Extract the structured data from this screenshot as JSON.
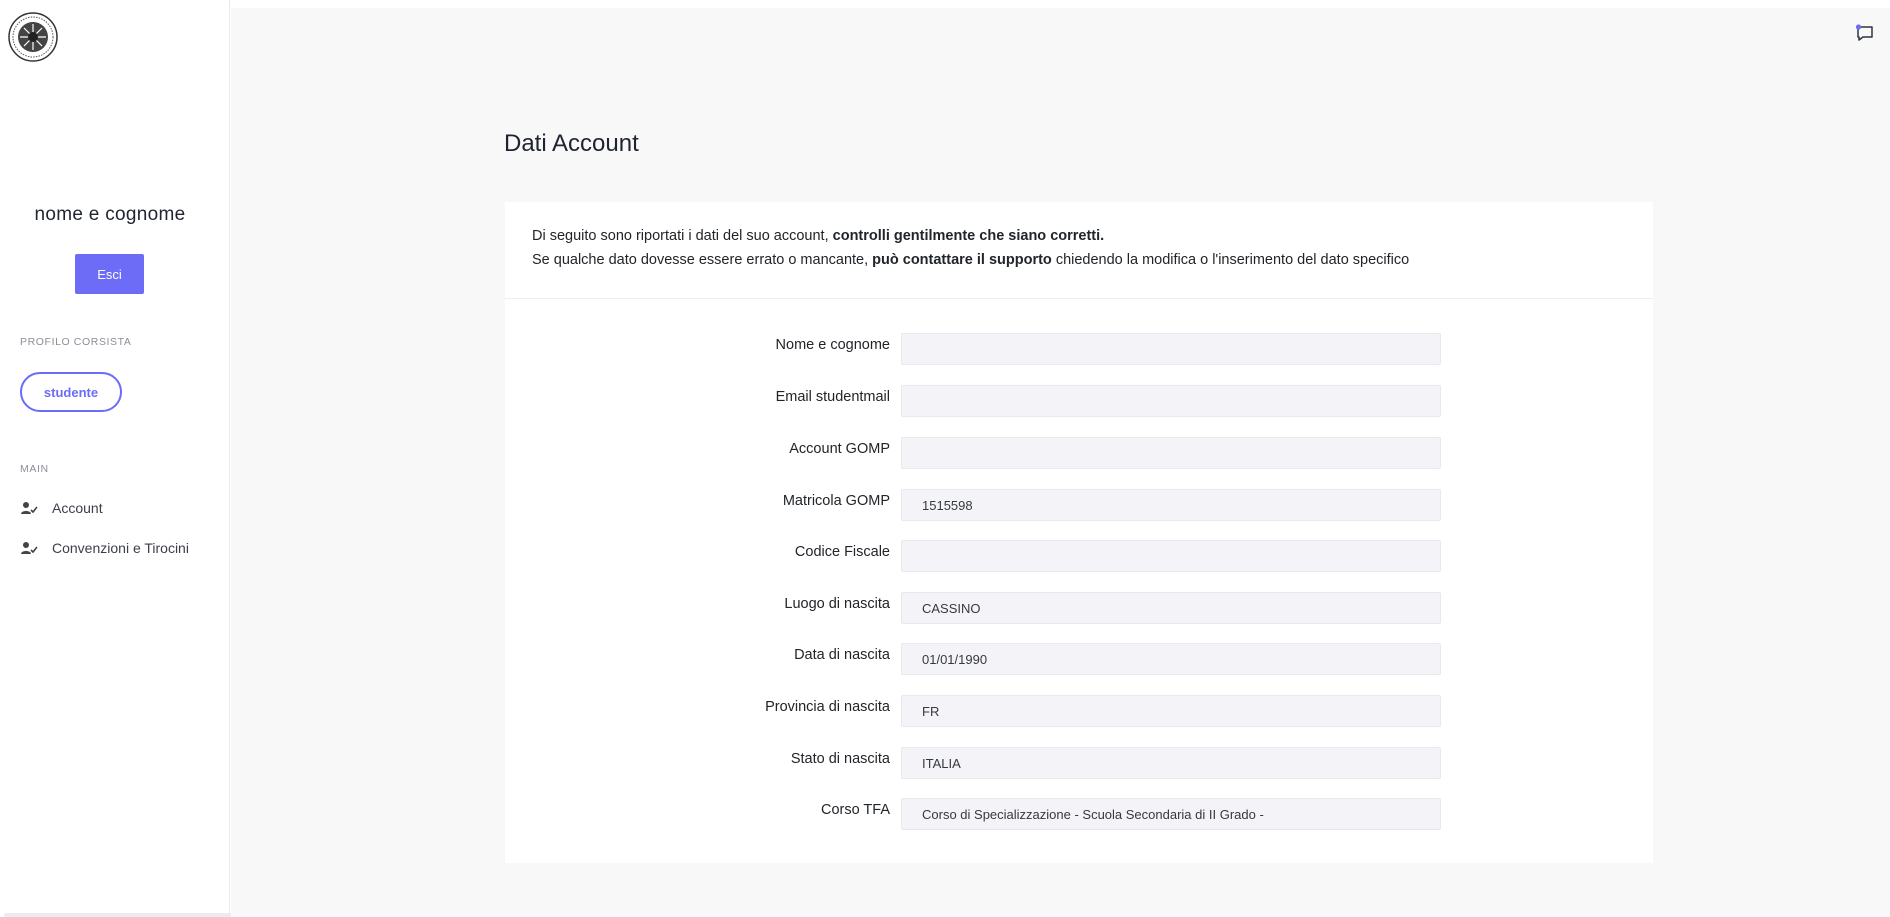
{
  "sidebar": {
    "user_name": "nome e cognome",
    "logout_label": "Esci",
    "profile_section": "PROFILO CORSISTA",
    "profile_role": "studente",
    "main_section": "MAIN",
    "items": [
      {
        "label": "Account",
        "icon": "user-check-icon"
      },
      {
        "label": "Convenzioni e Tirocini",
        "icon": "user-check-icon"
      }
    ]
  },
  "header": {
    "chat_icon": "chat-icon"
  },
  "page": {
    "title": "Dati Account",
    "intro_line1_normal": "Di seguito sono riportati i dati del suo account, ",
    "intro_line1_bold": "controlli gentilmente che siano corretti.",
    "intro_line2_normal_a": "Se qualche dato dovesse essere errato o mancante, ",
    "intro_line2_bold": "può contattare il supporto",
    "intro_line2_normal_b": " chiedendo la modifica o l'inserimento del dato specifico"
  },
  "form": {
    "fields": [
      {
        "label": "Nome e cognome",
        "value": ""
      },
      {
        "label": "Email studentmail",
        "value": ""
      },
      {
        "label": "Account GOMP",
        "value": ""
      },
      {
        "label": "Matricola GOMP",
        "value": "1515598"
      },
      {
        "label": "Codice Fiscale",
        "value": ""
      },
      {
        "label": "Luogo di nascita",
        "value": "CASSINO"
      },
      {
        "label": "Data di nascita",
        "value": "01/01/1990"
      },
      {
        "label": "Provincia di nascita",
        "value": "FR"
      },
      {
        "label": "Stato di nascita",
        "value": "ITALIA"
      },
      {
        "label": "Corso TFA",
        "value": "Corso di Specializzazione - Scuola Secondaria di II Grado -"
      }
    ]
  },
  "colors": {
    "accent": "#6c6cf7",
    "main_bg": "#f8f8f9",
    "input_bg": "#f4f4f8"
  }
}
